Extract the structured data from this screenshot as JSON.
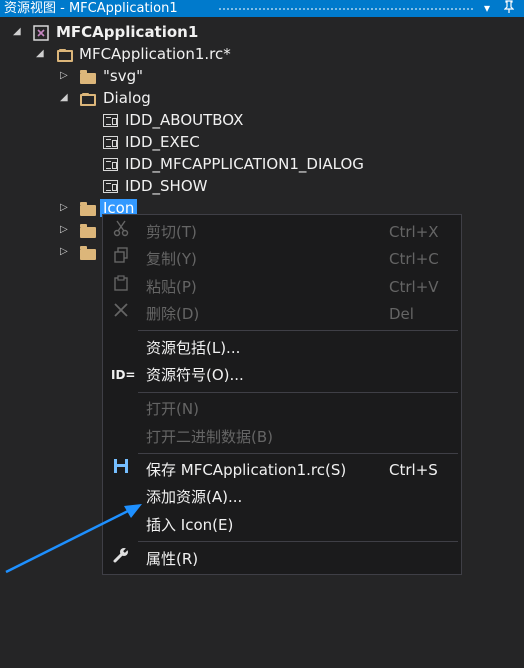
{
  "window": {
    "title": "资源视图 - MFCApplication1",
    "dropdown_icon": "▾",
    "pin_icon": "pin-icon"
  },
  "tree": {
    "project": "MFCApplication1",
    "rc_file": "MFCApplication1.rc*",
    "folder_svg": "\"svg\"",
    "folder_dialog": "Dialog",
    "dialogs": [
      "IDD_ABOUTBOX",
      "IDD_EXEC",
      "IDD_MFCAPPLICATION1_DIALOG",
      "IDD_SHOW"
    ],
    "folder_icon": "Icon"
  },
  "menu": {
    "cut": {
      "label": "剪切(T)",
      "shortcut": "Ctrl+X"
    },
    "copy": {
      "label": "复制(Y)",
      "shortcut": "Ctrl+C"
    },
    "paste": {
      "label": "粘贴(P)",
      "shortcut": "Ctrl+V"
    },
    "delete": {
      "label": "删除(D)",
      "shortcut": "Del"
    },
    "resource_includes": {
      "label": "资源包括(L)..."
    },
    "resource_symbols": {
      "label": "资源符号(O)...",
      "icon_text": "ID="
    },
    "open": {
      "label": "打开(N)"
    },
    "open_binary": {
      "label": "打开二进制数据(B)"
    },
    "save": {
      "label": "保存 MFCApplication1.rc(S)",
      "shortcut": "Ctrl+S"
    },
    "add_resource": {
      "label": "添加资源(A)..."
    },
    "insert_icon": {
      "label": "插入 Icon(E)"
    },
    "properties": {
      "label": "属性(R)"
    }
  },
  "colors": {
    "accent": "#007acc",
    "background": "#252526",
    "menu_background": "#1b1b1c",
    "selection": "#3399ff",
    "folder": "#dcb67a",
    "annotation_arrow": "#1e90ff"
  }
}
